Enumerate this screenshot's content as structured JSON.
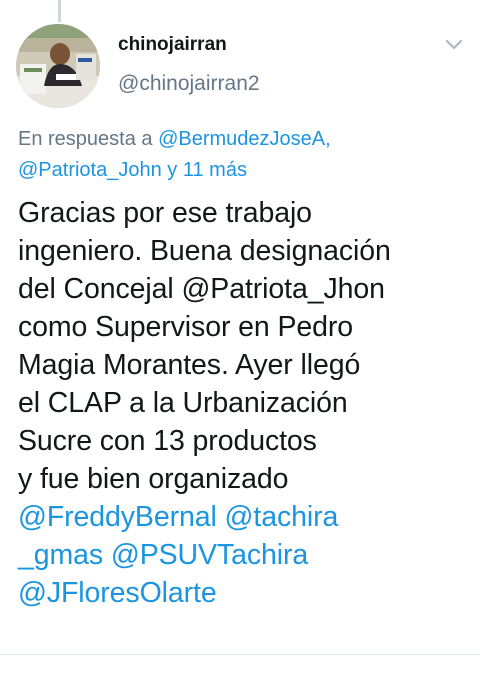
{
  "user": {
    "display_name": "chinojairran",
    "handle": "@chinojairran2",
    "avatar_icon": "profile-photo"
  },
  "menu": {
    "icon": "chevron-down-icon"
  },
  "reply_context": {
    "prefix": "En respuesta a",
    "mention_1": "@BermudezJoseA,",
    "mention_2": "@Patriota_John",
    "suffix": "y 11 más"
  },
  "tweet": {
    "lines": [
      "Gracias por ese trabajo",
      "ingeniero. Buena designación",
      "del Concejal @Patriota_Jhon",
      "como Supervisor en Pedro",
      "Magia Morantes. Ayer llegó",
      "el CLAP a la Urbanización",
      "Sucre con 13 productos",
      "y fue bien organizado"
    ],
    "mention_lines": {
      "line_a_1": "@FreddyBernal",
      "line_a_2": "@tachira",
      "line_b_1": "_gmas",
      "line_b_2": "@PSUVTachira",
      "line_c_1": "@JFloresOlarte"
    }
  },
  "colors": {
    "text": "#14171a",
    "secondary": "#657786",
    "link": "#1b95e0",
    "divider": "#e1e8ed"
  }
}
